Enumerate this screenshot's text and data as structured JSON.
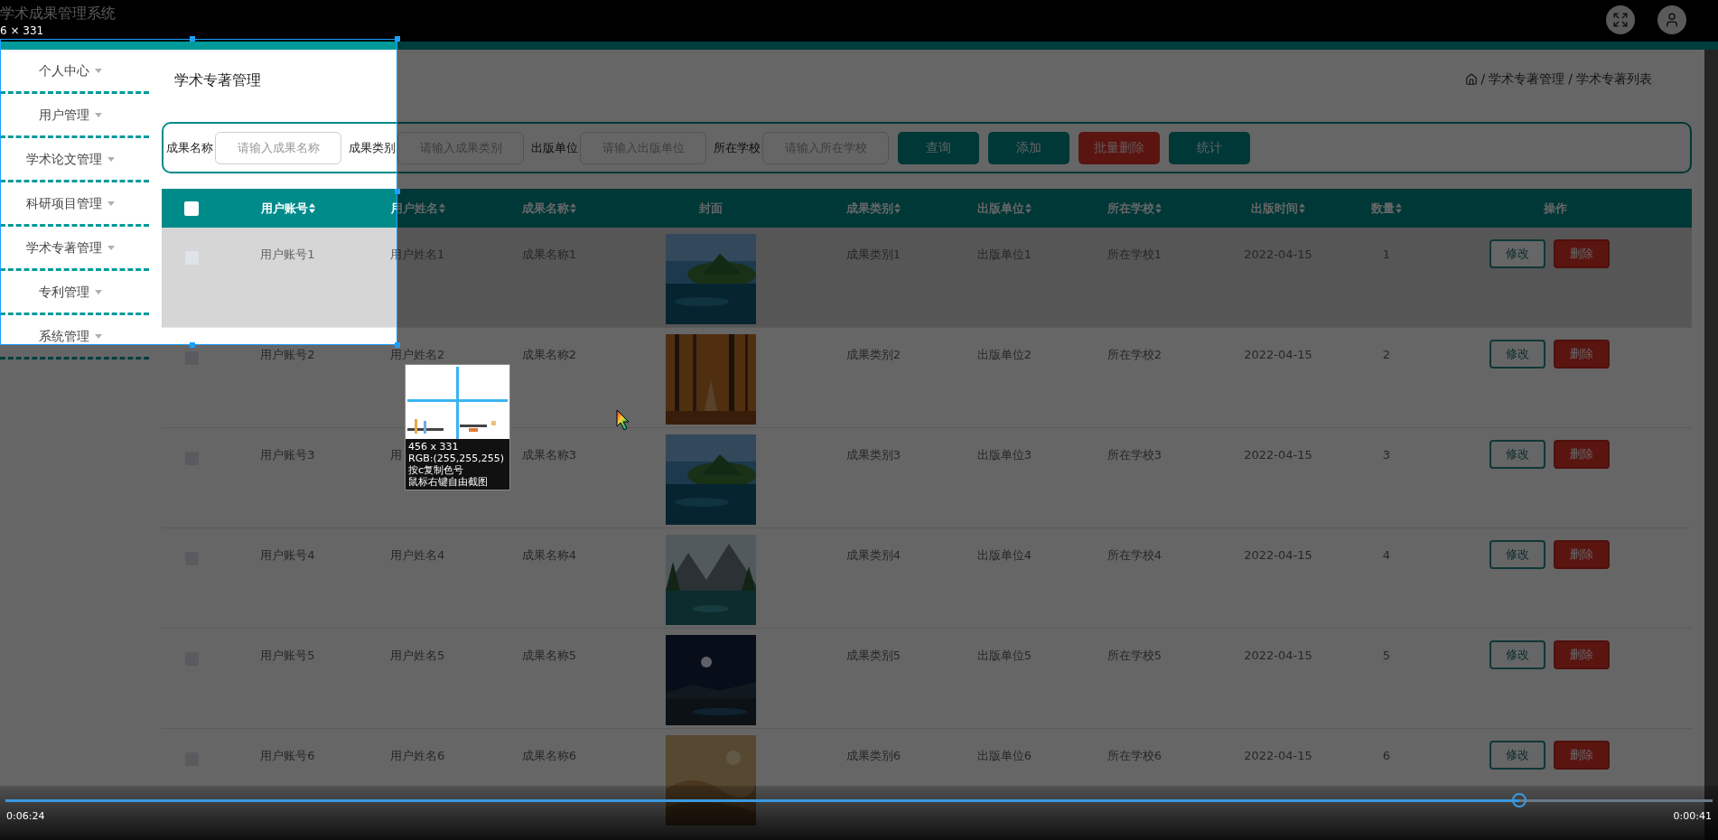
{
  "header": {
    "title": "学术成果管理系统"
  },
  "sidebar": {
    "items": [
      {
        "label": "个人中心"
      },
      {
        "label": "用户管理"
      },
      {
        "label": "学术论文管理"
      },
      {
        "label": "科研项目管理"
      },
      {
        "label": "学术专著管理"
      },
      {
        "label": "专利管理"
      },
      {
        "label": "系统管理"
      }
    ]
  },
  "page_title": "学术专著管理",
  "breadcrumb": {
    "separator": "/",
    "items": [
      "学术专著管理",
      "学术专著列表"
    ]
  },
  "search": {
    "fields": [
      {
        "label": "成果名称",
        "placeholder": "请输入成果名称"
      },
      {
        "label": "成果类别",
        "placeholder": "请输入成果类别"
      },
      {
        "label": "出版单位",
        "placeholder": "请输入出版单位"
      },
      {
        "label": "所在学校",
        "placeholder": "请输入所在学校"
      }
    ],
    "buttons": [
      {
        "label": "查询",
        "kind": "primary"
      },
      {
        "label": "添加",
        "kind": "primary"
      },
      {
        "label": "批量删除",
        "kind": "danger"
      },
      {
        "label": "统计",
        "kind": "primary"
      }
    ]
  },
  "table": {
    "select_all": {
      "checked": false
    },
    "columns": [
      {
        "label": "用户账号",
        "sortable": true
      },
      {
        "label": "用户姓名",
        "sortable": true
      },
      {
        "label": "成果名称",
        "sortable": true
      },
      {
        "label": "封面",
        "sortable": false
      },
      {
        "label": "成果类别",
        "sortable": true
      },
      {
        "label": "出版单位",
        "sortable": true
      },
      {
        "label": "所在学校",
        "sortable": true
      },
      {
        "label": "出版时间",
        "sortable": true
      },
      {
        "label": "数量",
        "sortable": true
      },
      {
        "label": "操作",
        "sortable": false
      }
    ],
    "rows": [
      {
        "checked": false,
        "hovered": true,
        "cells": [
          "用户账号1",
          "用户姓名1",
          "成果名称1",
          {
            "kind": "picture"
          },
          "成果类别1",
          "出版单位1",
          "所在学校1",
          "2022-04-15",
          "1"
        ],
        "actions": [
          {
            "label": "修改",
            "kind": "edit"
          },
          {
            "label": "删除",
            "kind": "delete"
          }
        ]
      },
      {
        "checked": false,
        "hovered": false,
        "cells": [
          "用户账号2",
          "用户姓名2",
          "成果名称2",
          {
            "kind": "picture"
          },
          "成果类别2",
          "出版单位2",
          "所在学校2",
          "2022-04-15",
          "2"
        ],
        "actions": [
          {
            "label": "修改",
            "kind": "edit"
          },
          {
            "label": "删除",
            "kind": "delete"
          }
        ]
      },
      {
        "checked": false,
        "hovered": false,
        "cells": [
          "用户账号3",
          "用",
          "成果名称3",
          {
            "kind": "picture"
          },
          "成果类别3",
          "出版单位3",
          "所在学校3",
          "2022-04-15",
          "3"
        ],
        "actions": [
          {
            "label": "修改",
            "kind": "edit"
          },
          {
            "label": "删除",
            "kind": "delete"
          }
        ]
      },
      {
        "checked": false,
        "hovered": false,
        "cells": [
          "用户账号4",
          "用户姓名4",
          "成果名称4",
          {
            "kind": "picture"
          },
          "成果类别4",
          "出版单位4",
          "所在学校4",
          "2022-04-15",
          "4"
        ],
        "actions": [
          {
            "label": "修改",
            "kind": "edit"
          },
          {
            "label": "删除",
            "kind": "delete"
          }
        ]
      },
      {
        "checked": false,
        "hovered": false,
        "cells": [
          "用户账号5",
          "用户姓名5",
          "成果名称5",
          {
            "kind": "picture"
          },
          "成果类别5",
          "出版单位5",
          "所在学校5",
          "2022-04-15",
          "5"
        ],
        "actions": [
          {
            "label": "修改",
            "kind": "edit"
          },
          {
            "label": "删除",
            "kind": "delete"
          }
        ]
      },
      {
        "checked": false,
        "hovered": false,
        "cells": [
          "用户账号6",
          "用户姓名6",
          "成果名称6",
          {
            "kind": "picture"
          },
          "成果类别6",
          "出版单位6",
          "所在学校6",
          "2022-04-15",
          "6"
        ],
        "actions": [
          {
            "label": "修改",
            "kind": "edit"
          },
          {
            "label": "删除",
            "kind": "delete"
          }
        ]
      }
    ]
  },
  "capture_tool": {
    "size_label": "6 × 331",
    "magnifier": {
      "lines": [
        "456 x 331",
        "RGB:(255,255,255)",
        "按c复制色号",
        "鼠标右键自由截图"
      ]
    }
  },
  "video": {
    "elapsed": "0:06:24",
    "remaining": "0:00:41",
    "level": 0.887
  }
}
